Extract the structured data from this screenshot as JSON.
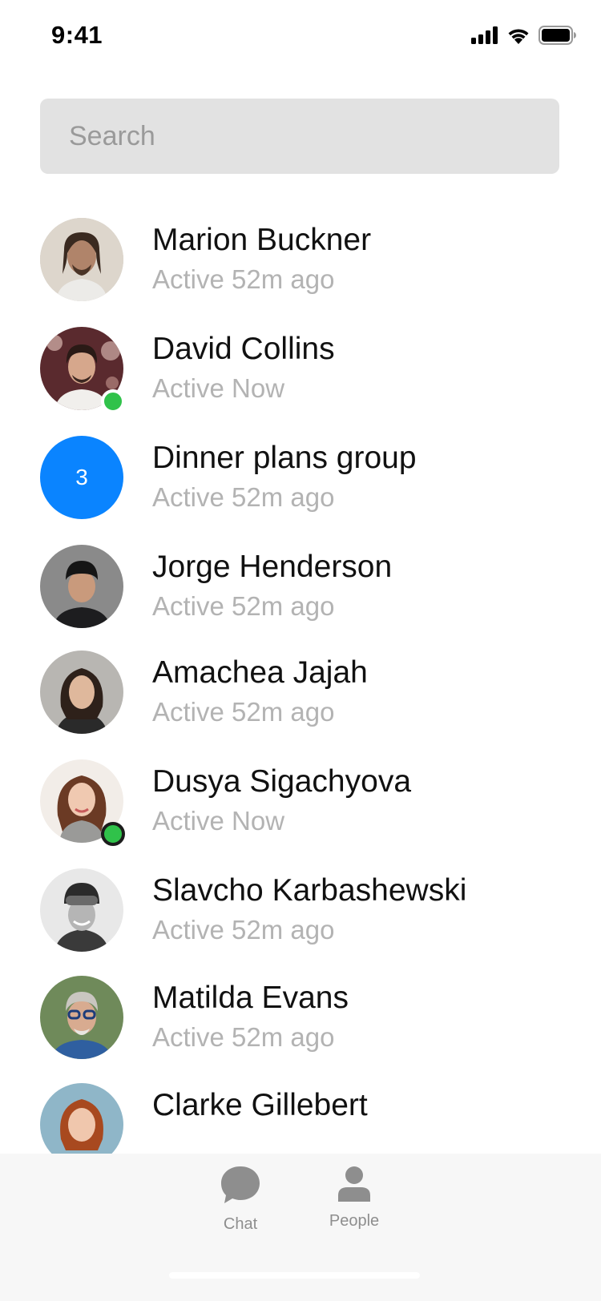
{
  "status_bar": {
    "time": "9:41",
    "icons": [
      "cellular-signal-icon",
      "wifi-icon",
      "battery-icon"
    ]
  },
  "search": {
    "placeholder": "Search"
  },
  "people": [
    {
      "name": "Marion Buckner",
      "status": "Active 52m ago",
      "online": false,
      "avatar": "photo"
    },
    {
      "name": "David Collins",
      "status": "Active Now",
      "online": true,
      "avatar": "photo"
    },
    {
      "name": "Dinner plans group",
      "status": "Active 52m ago",
      "online": false,
      "avatar": "group",
      "avatar_text": "3"
    },
    {
      "name": "Jorge Henderson",
      "status": "Active 52m ago",
      "online": false,
      "avatar": "photo"
    },
    {
      "name": "Amachea Jajah",
      "status": "Active 52m ago",
      "online": false,
      "avatar": "photo"
    },
    {
      "name": "Dusya Sigachyova",
      "status": "Active Now",
      "online": true,
      "avatar": "photo"
    },
    {
      "name": "Slavcho Karbashewski",
      "status": "Active 52m ago",
      "online": false,
      "avatar": "photo"
    },
    {
      "name": "Matilda Evans",
      "status": "Active 52m ago",
      "online": false,
      "avatar": "photo"
    },
    {
      "name": "Clarke Gillebert",
      "status": "",
      "online": false,
      "avatar": "photo"
    }
  ],
  "tab_bar": {
    "tabs": [
      {
        "label": "Chat",
        "icon": "chat-bubble-icon"
      },
      {
        "label": "People",
        "icon": "person-icon"
      }
    ]
  },
  "colors": {
    "accent": "#0a84ff",
    "online": "#30c24a",
    "secondary_text": "#b3b3b3",
    "search_bg": "#e2e2e2",
    "tab_bar_bg": "#f7f7f7"
  }
}
